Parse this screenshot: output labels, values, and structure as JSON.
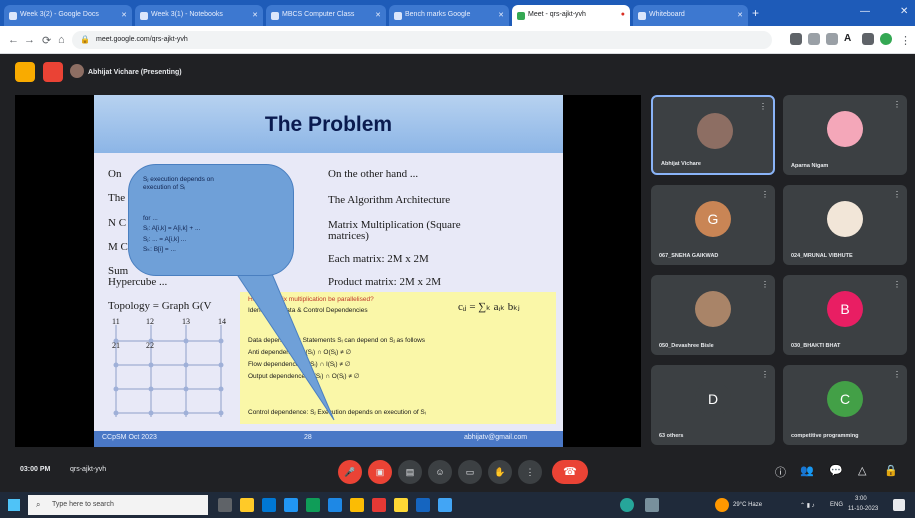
{
  "browser": {
    "tabs": [
      {
        "label": "Week 3(2) - Google Docs"
      },
      {
        "label": "Week 3(1) - Notebooks"
      },
      {
        "label": "MBCS Computer Class"
      },
      {
        "label": "Bench marks Google"
      },
      {
        "label": "Meet - qrs-ajkt-yvh",
        "active": true
      },
      {
        "label": "Whiteboard"
      }
    ],
    "url": "meet.google.com/qrs-ajkt-yvh",
    "profile_initial": "A"
  },
  "meet": {
    "presenter_label": "Abhijat Vichare (Presenting)",
    "time": "03:00 PM",
    "meeting_code": "qrs-ajkt-yvh",
    "participants": [
      {
        "name": "Abhijat Vichare",
        "initial": "",
        "color": "#8d6e63",
        "speaking": true
      },
      {
        "name": "Aparna Nigam",
        "initial": "",
        "color": "#f4a7b9"
      },
      {
        "name": "067_SNEHA GAIKWAD",
        "initial": "G",
        "color": "#c98555"
      },
      {
        "name": "024_MRUNAL VIBHUTE",
        "initial": "",
        "color": "#f2e6d8"
      },
      {
        "name": "050_Devashree Bisle",
        "initial": "",
        "color": "#a98468"
      },
      {
        "name": "030_BHAKTI BHAT",
        "initial": "B",
        "color": "#e91e63"
      },
      {
        "name": "63 others",
        "initial": "D",
        "color": "#3c4043"
      },
      {
        "name": "competitive programming",
        "initial": "C",
        "color": "#43a047"
      }
    ]
  },
  "slide": {
    "title": "The Problem",
    "left_col": [
      "On",
      "The",
      "N C",
      "M C",
      "Sum",
      "Hypercube ...",
      "Topology = Graph G(V"
    ],
    "right_col": [
      "On the other hand ...",
      "The Algorithm Architecture",
      "Matrix Multiplication (Square",
      "matrices)",
      "Each matrix: 2M x 2M",
      "Product matrix: 2M x 2M"
    ],
    "bubble_lines": [
      "Sⱼ execution depends on",
      "execution of Sᵢ",
      "for ...",
      "  Sᵢ: A[i,k] = A[i,k] + ...",
      "  Sⱼ: ... = A[i,k] ...",
      "  Sₖ: B[i] = ..."
    ],
    "grid_labels": [
      "11",
      "12",
      "13",
      "14",
      "21",
      "22"
    ],
    "formula": "cᵢⱼ = ∑ₖ aᵢₖ bₖⱼ",
    "yellow_lines": [
      "How is matrix multiplication be parallelised?",
      "Identify the Data & Control Dependencies",
      "Data dependency: Statements Sᵢ can depend on Sⱼ as follows",
      "Anti dependence:     O(Sᵢ) ∩ O(Sⱼ) ≠ ∅",
      "Flow dependence:     O(Sᵢ) ∩ I(Sⱼ) ≠ ∅",
      "Output dependence:   O(Sᵢ) ∩ O(Sⱼ) ≠ ∅",
      "Control dependence: Sⱼ Execution depends on execution of Sᵢ"
    ],
    "footer": {
      "left": "CCpSM  Oct 2023",
      "page": "28",
      "email": "abhijatv@gmail.com"
    }
  },
  "taskbar": {
    "search_placeholder": "Type here to search",
    "weather": "29°C Haze",
    "lang": "ENG",
    "clock_time": "3:00",
    "clock_date": "11-10-2023"
  }
}
